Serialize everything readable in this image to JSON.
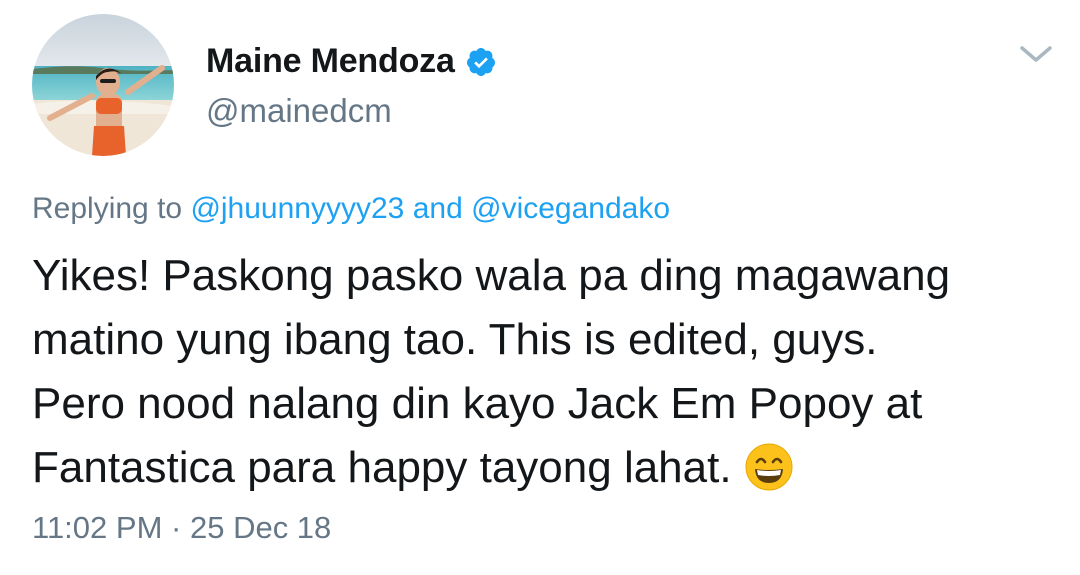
{
  "author": {
    "display_name": "Maine Mendoza",
    "handle": "@mainedcm",
    "verified": true,
    "avatar_icon": "profile-photo-beach"
  },
  "reply": {
    "prefix": "Replying to",
    "mention_1": "@jhuunnyyyy23",
    "conjunction": "and",
    "mention_2": "@vicegandako"
  },
  "tweet": {
    "lines": [
      "Yikes! Paskong pasko wala pa ding magawang",
      "matino yung ibang tao. This is edited, guys.",
      "Pero nood nalang din kayo Jack Em Popoy at",
      "Fantastica para happy tayong lahat."
    ],
    "emoji": "grinning-face-with-smiling-eyes"
  },
  "meta": {
    "time": "11:02 PM",
    "separator": "·",
    "date": "25 Dec 18"
  },
  "colors": {
    "text": "#14171a",
    "secondary": "#657786",
    "link": "#1da1f2",
    "verified": "#1da1f2"
  }
}
